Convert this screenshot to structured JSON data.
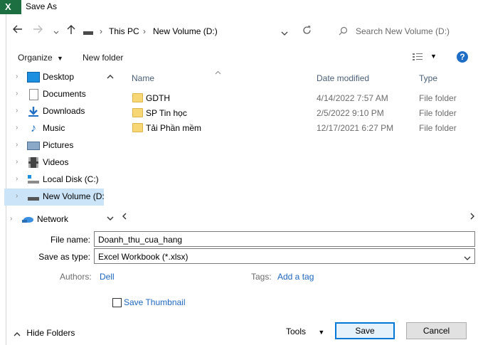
{
  "window": {
    "title": "Save As",
    "app_icon": "X"
  },
  "nav": {
    "breadcrumb": [
      "This PC",
      "New Volume (D:)"
    ],
    "search_placeholder": "Search New Volume (D:)"
  },
  "toolbar": {
    "organize_label": "Organize",
    "new_folder_label": "New folder",
    "help_label": "?"
  },
  "sidebar": {
    "items": [
      {
        "label": "Desktop"
      },
      {
        "label": "Documents"
      },
      {
        "label": "Downloads"
      },
      {
        "label": "Music"
      },
      {
        "label": "Pictures"
      },
      {
        "label": "Videos"
      },
      {
        "label": "Local Disk (C:)"
      },
      {
        "label": "New Volume (D:"
      },
      {
        "label": "Network"
      }
    ]
  },
  "columns": {
    "name": "Name",
    "date_modified": "Date modified",
    "type": "Type"
  },
  "files": [
    {
      "name": "GDTH",
      "date": "4/14/2022 7:57 AM",
      "type": "File folder"
    },
    {
      "name": "SP Tin học",
      "date": "2/5/2022 9:10 PM",
      "type": "File folder"
    },
    {
      "name": "Tải Phần mềm",
      "date": "12/17/2021 6:27 PM",
      "type": "File folder"
    }
  ],
  "form": {
    "file_name_label": "File name:",
    "file_name_value": "Doanh_thu_cua_hang",
    "save_type_label": "Save as type:",
    "save_type_value": "Excel Workbook (*.xlsx)",
    "authors_label": "Authors:",
    "authors_value": "Dell",
    "tags_label": "Tags:",
    "tags_value": "Add a tag",
    "thumbnail_label": "Save Thumbnail"
  },
  "footer": {
    "hide_folders_label": "Hide Folders",
    "tools_label": "Tools",
    "save_label": "Save",
    "cancel_label": "Cancel"
  },
  "colors": {
    "accent": "#0078d7",
    "selected": "#cce4f7",
    "link": "#1e66c0",
    "excel_green": "#1d6f42"
  }
}
